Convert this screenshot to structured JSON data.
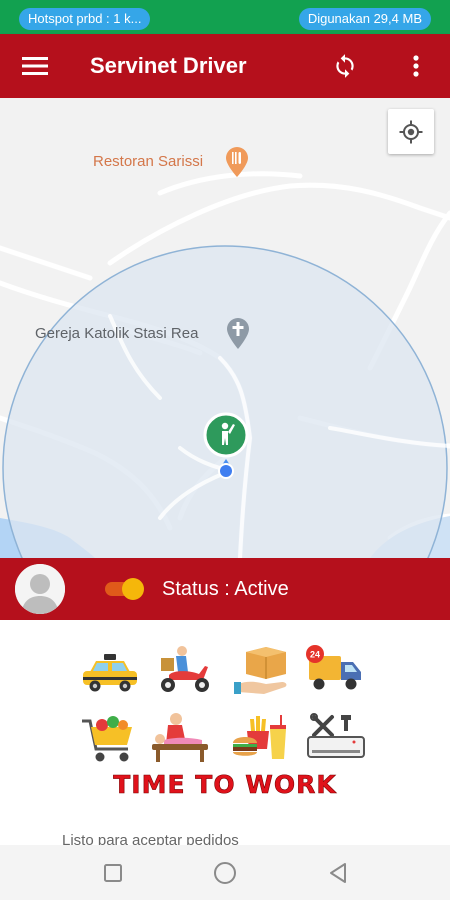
{
  "status_bar": {
    "hotspot_text": "Hotspot prbd : 1 k...",
    "data_usage_text": "Digunakan 29,4 MB"
  },
  "app_bar": {
    "title": "Servinet Driver",
    "menu_icon": "hamburger-menu-icon",
    "refresh_icon": "sync-icon",
    "overflow_icon": "more-vert-icon"
  },
  "map": {
    "poi_restaurant": "Restoran Sarissi",
    "poi_church": "Gereja Katolik Stasi Rea",
    "my_location_icon": "gps-crosshair-icon",
    "driver_marker_icon": "waving-person-icon",
    "restaurant_icon": "fork-knife-icon",
    "church_icon": "cross-icon",
    "colors": {
      "radius_fill": "#dce6f0",
      "radius_stroke": "#8fb3d6",
      "marker": "#2e9a5c",
      "water": "#b3d4f5"
    }
  },
  "driver_status": {
    "status_text": "Status : Active",
    "toggle_on": true,
    "avatar_icon": "user-avatar-icon"
  },
  "services": [
    {
      "name": "taxi",
      "icon": "taxi-icon"
    },
    {
      "name": "motorbike-delivery",
      "icon": "scooter-courier-icon"
    },
    {
      "name": "package",
      "icon": "package-hand-icon"
    },
    {
      "name": "24h-truck",
      "icon": "delivery-truck-24-icon"
    },
    {
      "name": "shopping",
      "icon": "shopping-cart-icon"
    },
    {
      "name": "massage",
      "icon": "massage-icon"
    },
    {
      "name": "food",
      "icon": "fast-food-icon"
    },
    {
      "name": "repair",
      "icon": "ac-repair-tools-icon"
    }
  ],
  "banner_text": "TIME TO WORK",
  "footnote_text": "Listo para aceptar pedidos",
  "colors": {
    "brand_red": "#b5101c",
    "status_green": "#12a150",
    "pill_blue": "#35a6e8",
    "toggle_orange": "#f5b70a"
  }
}
